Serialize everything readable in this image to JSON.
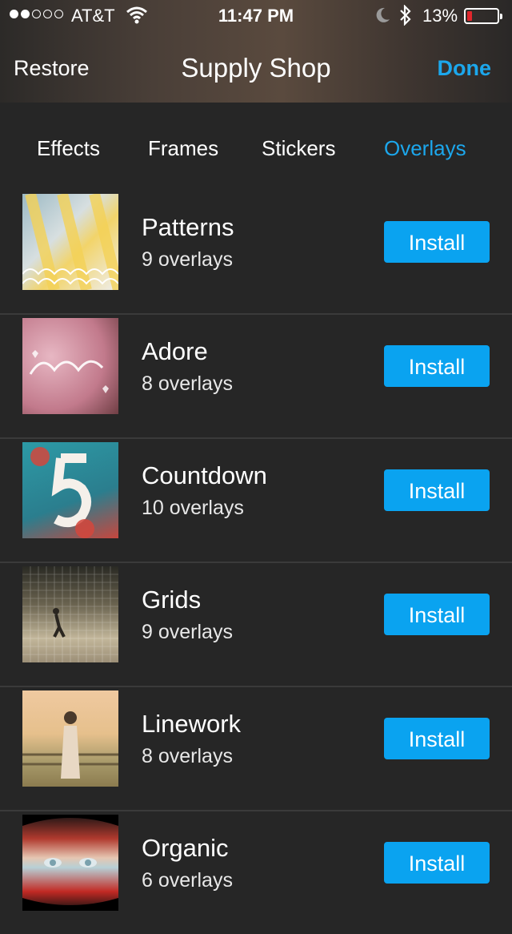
{
  "status_bar": {
    "carrier": "AT&T",
    "time": "11:47 PM",
    "battery": "13%",
    "battery_level": 0.13,
    "signal_bars": 2
  },
  "nav": {
    "left": "Restore",
    "title": "Supply Shop",
    "right": "Done"
  },
  "tabs": [
    {
      "label": "Effects",
      "active": false
    },
    {
      "label": "Frames",
      "active": false
    },
    {
      "label": "Stickers",
      "active": false
    },
    {
      "label": "Overlays",
      "active": true
    }
  ],
  "items": [
    {
      "name": "Patterns",
      "count": "9 overlays",
      "button": "Install"
    },
    {
      "name": "Adore",
      "count": "8 overlays",
      "button": "Install"
    },
    {
      "name": "Countdown",
      "count": "10 overlays",
      "button": "Install"
    },
    {
      "name": "Grids",
      "count": "9 overlays",
      "button": "Install"
    },
    {
      "name": "Linework",
      "count": "8 overlays",
      "button": "Install"
    },
    {
      "name": "Organic",
      "count": "6 overlays",
      "button": "Install"
    }
  ],
  "colors": {
    "accent": "#1ca7ec",
    "install_button": "#0aa3f0",
    "background": "#262626",
    "battery_low": "#e0262c"
  }
}
